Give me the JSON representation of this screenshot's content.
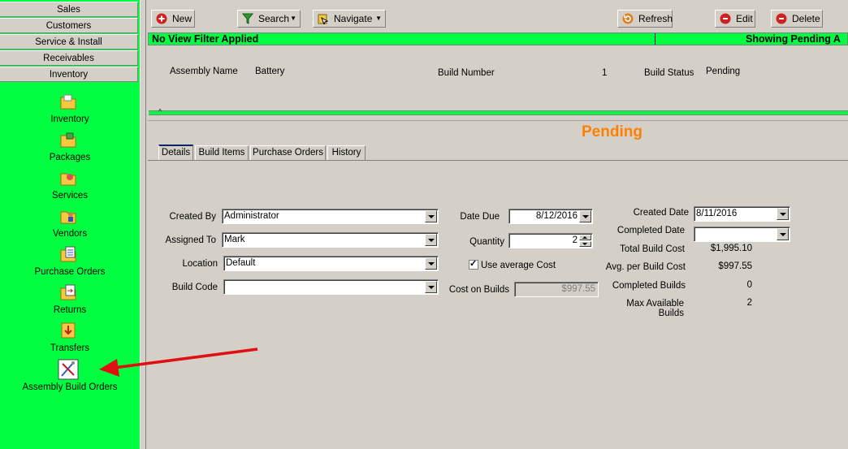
{
  "nav": {
    "buttons": [
      "Sales",
      "Customers",
      "Service & Install",
      "Receivables",
      "Inventory"
    ],
    "items": [
      "Inventory",
      "Packages",
      "Services",
      "Vendors",
      "Purchase Orders",
      "Returns",
      "Transfers",
      "Assembly Build Orders"
    ]
  },
  "toolbar": {
    "new": "New",
    "search": "Search",
    "navigate": "Navigate",
    "refresh": "Refresh",
    "edit": "Edit",
    "delete": "Delete"
  },
  "filterbar": {
    "left": "No View Filter Applied",
    "right": "Showing Pending A"
  },
  "header": {
    "assembly_name_label": "Assembly Name",
    "assembly_name": "Battery",
    "build_number_label": "Build Number",
    "build_number": "1",
    "build_status_label": "Build Status",
    "build_status": "Pending"
  },
  "status_banner": "Pending",
  "tabs": [
    "Details",
    "Build Items",
    "Purchase Orders",
    "History"
  ],
  "form": {
    "created_by_label": "Created By",
    "created_by": "Administrator",
    "assigned_to_label": "Assigned To",
    "assigned_to": "Mark",
    "location_label": "Location",
    "location": "Default",
    "build_code_label": "Build Code",
    "build_code": "",
    "date_due_label": "Date Due",
    "date_due": "8/12/2016",
    "quantity_label": "Quantity",
    "quantity": "2",
    "use_avg_cost_label": "Use average Cost",
    "cost_on_builds_label": "Cost on Builds",
    "cost_on_builds": "$997.55",
    "created_date_label": "Created Date",
    "created_date": "8/11/2016",
    "completed_date_label": "Completed Date",
    "completed_date": "",
    "total_build_cost_label": "Total Build Cost",
    "total_build_cost": "$1,995.10",
    "avg_per_build_cost_label": "Avg. per Build Cost",
    "avg_per_build_cost": "$997.55",
    "completed_builds_label": "Completed Builds",
    "completed_builds": "0",
    "max_available_builds_label": "Max Available Builds",
    "max_available_builds": "2"
  },
  "colors": {
    "accent_green": "#00ff40",
    "status_orange": "#ff8000",
    "arrow_red": "#e01010"
  }
}
